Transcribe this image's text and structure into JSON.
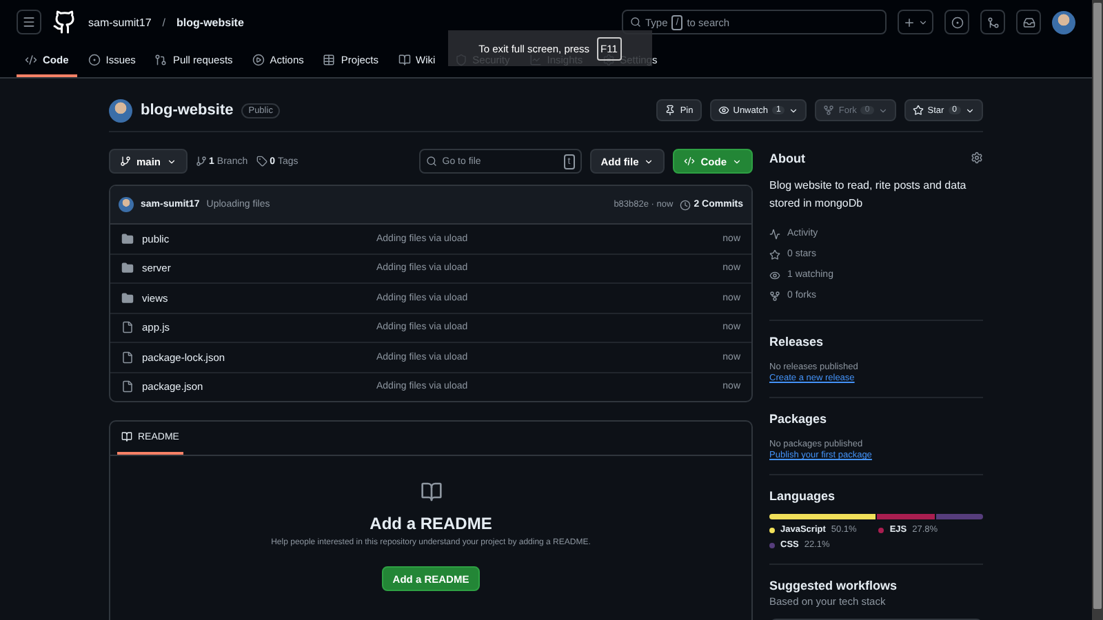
{
  "header": {
    "owner": "sam-sumit17",
    "separator": "/",
    "repo": "blog-website",
    "search": {
      "before": "Type",
      "key": "/",
      "after": "to search"
    }
  },
  "tabs": [
    {
      "label": "Code",
      "selected": true
    },
    {
      "label": "Issues",
      "selected": false
    },
    {
      "label": "Pull requests",
      "selected": false
    },
    {
      "label": "Actions",
      "selected": false
    },
    {
      "label": "Projects",
      "selected": false
    },
    {
      "label": "Wiki",
      "selected": false
    },
    {
      "label": "Security",
      "selected": false
    },
    {
      "label": "Insights",
      "selected": false
    },
    {
      "label": "Settings",
      "selected": false
    }
  ],
  "fullscreen_notice": {
    "text": "To exit full screen, press",
    "key": "F11"
  },
  "repo": {
    "name": "blog-website",
    "visibility": "Public"
  },
  "repo_actions": [
    {
      "kind": "pin",
      "label": "Pin",
      "disabled": false
    },
    {
      "kind": "watch",
      "label": "Unwatch",
      "count": "1",
      "disabled": false
    },
    {
      "kind": "fork",
      "label": "Fork",
      "count": "0",
      "disabled": true
    },
    {
      "kind": "star",
      "label": "Star",
      "count": "0",
      "disabled": false
    }
  ],
  "branch": {
    "name": "main",
    "branch_count": "1",
    "branch_label": "Branch",
    "tag_count": "0",
    "tag_label": "Tags"
  },
  "go_to_file": {
    "placeholder": "Go to file",
    "key": "t"
  },
  "add_file": "Add file",
  "code_button": "Code",
  "commit": {
    "author": "sam-sumit17",
    "message": "Uploading files",
    "hash_time": "b83b82e · now",
    "commits": "2 Commits"
  },
  "files": [
    {
      "kind": "folder",
      "name": "public",
      "message": "Adding files via uload",
      "time": "now"
    },
    {
      "kind": "folder",
      "name": "server",
      "message": "Adding files via uload",
      "time": "now"
    },
    {
      "kind": "folder",
      "name": "views",
      "message": "Adding files via uload",
      "time": "now"
    },
    {
      "kind": "file",
      "name": "app.js",
      "message": "Adding files via uload",
      "time": "now"
    },
    {
      "kind": "file",
      "name": "package-lock.json",
      "message": "Adding files via uload",
      "time": "now"
    },
    {
      "kind": "file",
      "name": "package.json",
      "message": "Adding files via uload",
      "time": "now"
    }
  ],
  "readme": {
    "tab": "README",
    "title": "Add a README",
    "description": "Help people interested in this repository understand your project by adding a README.",
    "button": "Add a README"
  },
  "about": {
    "title": "About",
    "description": "Blog website to read, rite posts and data stored in mongoDb",
    "stats": [
      {
        "kind": "activity",
        "label": "Activity"
      },
      {
        "kind": "star",
        "label": "0 stars"
      },
      {
        "kind": "eye",
        "label": "1 watching"
      },
      {
        "kind": "fork",
        "label": "0 forks"
      }
    ]
  },
  "releases": {
    "title": "Releases",
    "empty": "No releases published",
    "link": "Create a new release"
  },
  "packages": {
    "title": "Packages",
    "empty": "No packages published",
    "link": "Publish your first package"
  },
  "languages": {
    "title": "Languages",
    "items": [
      {
        "name": "JavaScript",
        "percent": "50.1%",
        "color": "#f1e05a"
      },
      {
        "name": "EJS",
        "percent": "27.8%",
        "color": "#a91e50"
      },
      {
        "name": "CSS",
        "percent": "22.1%",
        "color": "#563d7c"
      }
    ]
  },
  "workflows": {
    "title": "Suggested workflows",
    "subtitle": "Based on your tech stack"
  }
}
